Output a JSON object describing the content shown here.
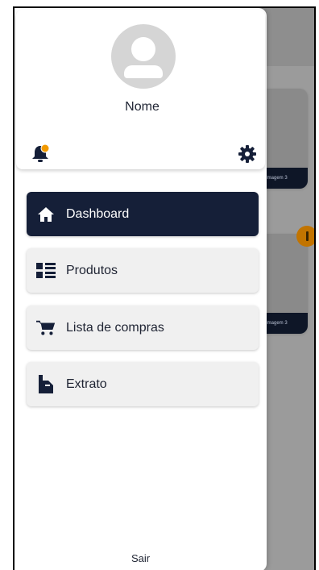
{
  "background": {
    "card_1_caption": "Imagem 3",
    "card_2_caption": "Imagem 3"
  },
  "drawer": {
    "user_name": "Nome",
    "menu": [
      {
        "label": "Dashboard",
        "icon": "home-icon",
        "active": true
      },
      {
        "label": "Produtos",
        "icon": "list-icon",
        "active": false
      },
      {
        "label": "Lista de compras",
        "icon": "cart-icon",
        "active": false
      },
      {
        "label": "Extrato",
        "icon": "receipt-icon",
        "active": false
      }
    ],
    "logout_label": "Sair"
  },
  "colors": {
    "active_item": "#151f38",
    "notification_dot": "#f29a00",
    "overlay_badge": "#c27400"
  }
}
